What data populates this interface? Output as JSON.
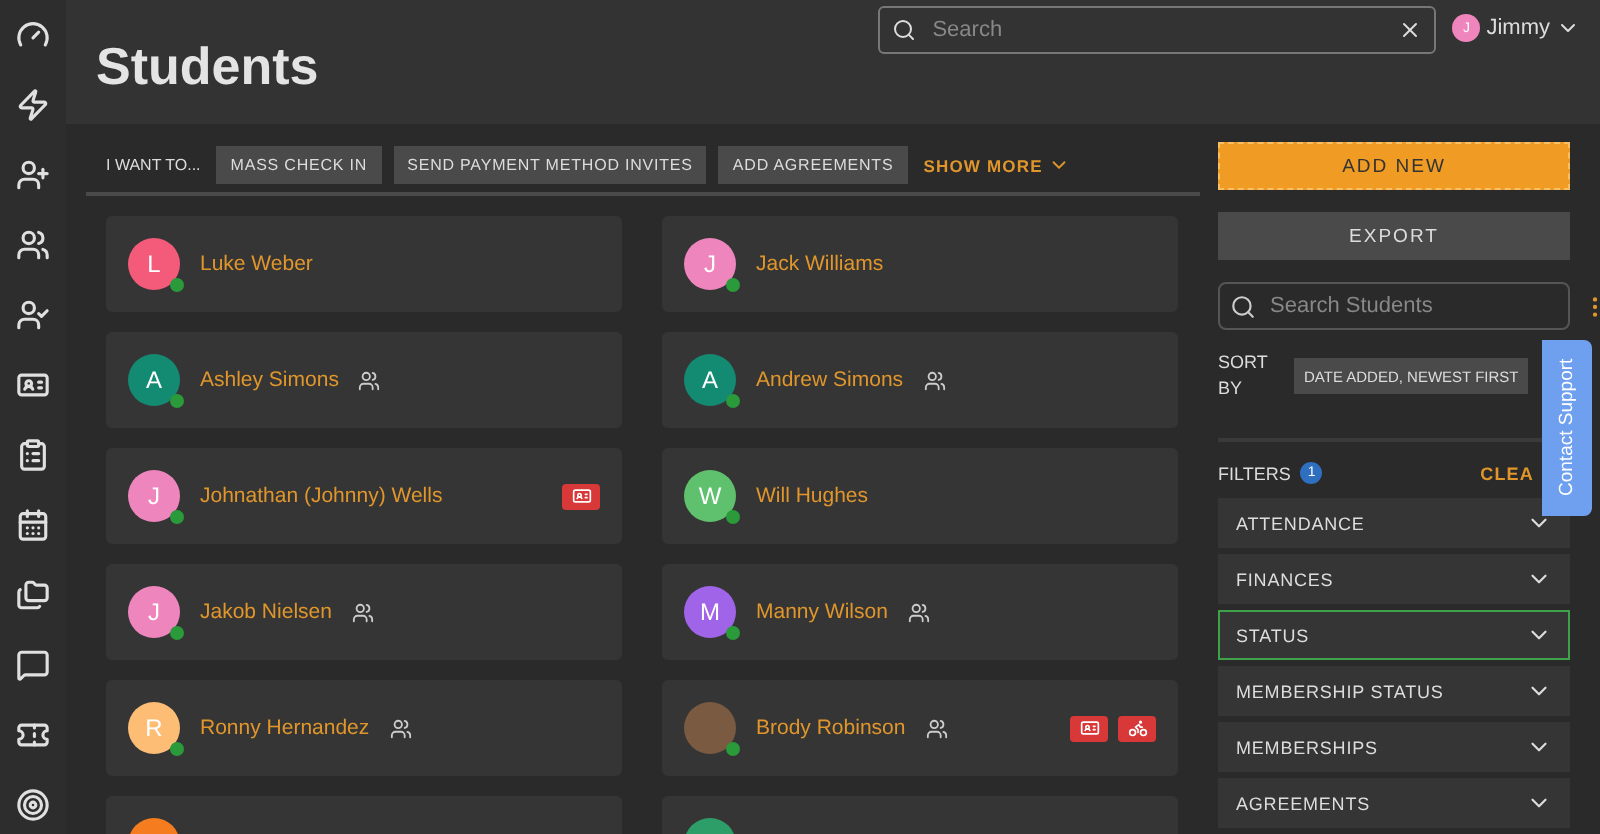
{
  "page_title": "Students",
  "search": {
    "placeholder": "Search"
  },
  "user": {
    "initial": "J",
    "name": "Jimmy"
  },
  "sidebar": {
    "items": [
      {
        "selected": false
      },
      {
        "selected": false
      },
      {
        "selected": false
      },
      {
        "selected": false
      },
      {
        "selected": false
      },
      {
        "selected": false
      },
      {
        "selected": false
      },
      {
        "selected": false
      },
      {
        "selected": false
      },
      {
        "selected": false
      },
      {
        "selected": false
      },
      {
        "selected": false
      }
    ]
  },
  "actions": {
    "label": "I WANT TO...",
    "buttons": [
      "MASS CHECK IN",
      "SEND PAYMENT METHOD INVITES",
      "ADD AGREEMENTS"
    ],
    "show_more": "SHOW MORE"
  },
  "students": [
    {
      "name": "Luke Weber",
      "initial": "L",
      "color": "#f45b7a",
      "online": true,
      "family": false
    },
    {
      "name": "Jack Williams",
      "initial": "J",
      "color": "#ee86bd",
      "online": true,
      "family": false
    },
    {
      "name": "Ashley Simons",
      "initial": "A",
      "color": "#138a72",
      "online": true,
      "family": true
    },
    {
      "name": "Andrew Simons",
      "initial": "A",
      "color": "#138a72",
      "online": true,
      "family": true
    },
    {
      "name": "Johnathan (Johnny) Wells",
      "initial": "J",
      "color": "#ee86bd",
      "online": true,
      "family": false,
      "id_card_badge": true
    },
    {
      "name": "Will Hughes",
      "initial": "W",
      "color": "#5fc16e",
      "online": true,
      "family": false
    },
    {
      "name": "Jakob Nielsen",
      "initial": "J",
      "color": "#ee86bd",
      "online": true,
      "family": true
    },
    {
      "name": "Manny Wilson",
      "initial": "M",
      "color": "#a064e8",
      "online": true,
      "family": true
    },
    {
      "name": "Ronny Hernandez",
      "initial": "R",
      "color": "#fdbd75",
      "online": true,
      "family": true
    },
    {
      "name": "Brody Robinson",
      "photo": true,
      "online": true,
      "family": true,
      "id_card_badge": true,
      "payment_badge": true
    },
    {
      "color": "#f57c1f"
    },
    {
      "color": "#2e9e68"
    }
  ],
  "panel": {
    "add_new": "ADD NEW",
    "export": "EXPORT",
    "search_placeholder": "Search Students",
    "sort_label": "SORT BY",
    "sort_value": "DATE ADDED, NEWEST FIRST",
    "filters_label": "FILTERS",
    "filters_count": "1",
    "clear": "CLEA",
    "filters": [
      {
        "label": "ATTENDANCE",
        "selected": false
      },
      {
        "label": "FINANCES",
        "selected": false
      },
      {
        "label": "STATUS",
        "selected": true
      },
      {
        "label": "MEMBERSHIP STATUS",
        "selected": false
      },
      {
        "label": "MEMBERSHIPS",
        "selected": false
      },
      {
        "label": "AGREEMENTS",
        "selected": false
      }
    ]
  },
  "support_tab": "Contact Support"
}
